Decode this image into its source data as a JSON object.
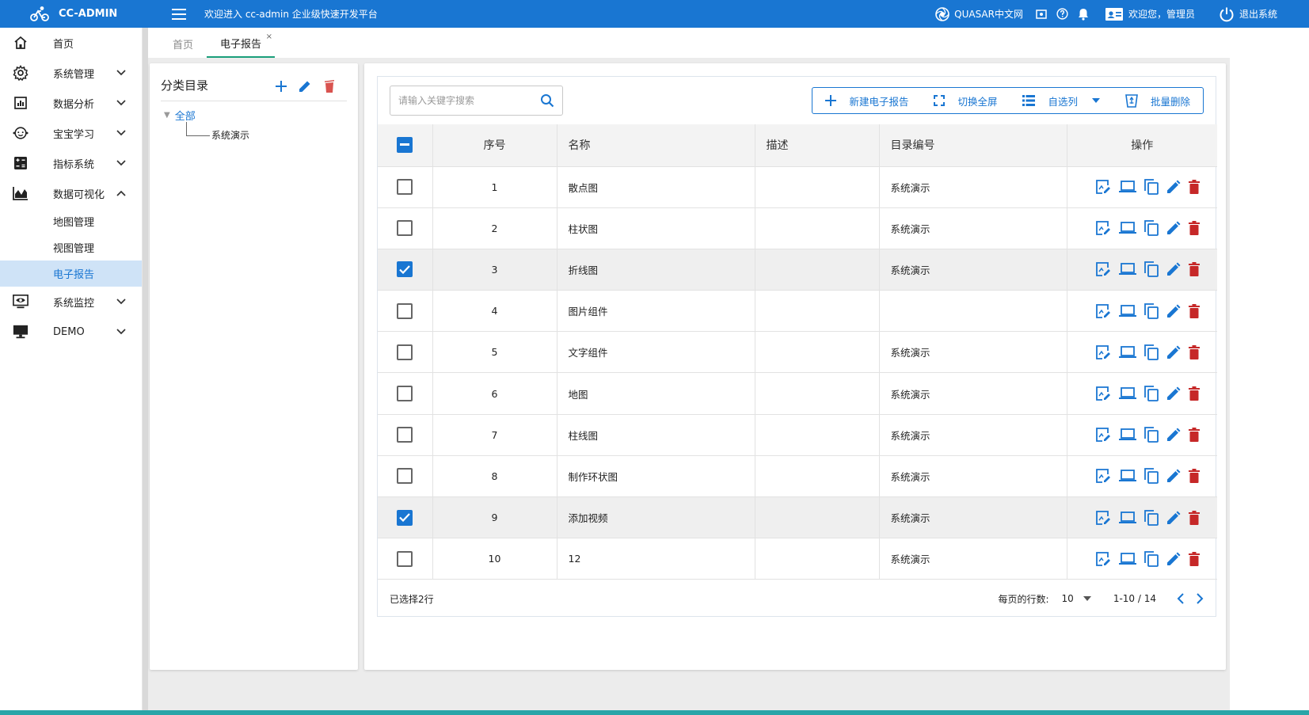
{
  "header": {
    "app_name": "CC-ADMIN",
    "welcome": "欢迎进入 cc-admin 企业级快速开发平台",
    "quasar_link": "QUASAR中文网",
    "user_text": "欢迎您，管理员",
    "logout": "退出系统"
  },
  "sidebar": {
    "items": [
      {
        "label": "首页"
      },
      {
        "label": "系统管理"
      },
      {
        "label": "数据分析"
      },
      {
        "label": "宝宝学习"
      },
      {
        "label": "指标系统"
      },
      {
        "label": "数据可视化"
      },
      {
        "label": "系统监控"
      },
      {
        "label": "DEMO"
      }
    ],
    "sub_items": [
      {
        "label": "地图管理"
      },
      {
        "label": "视图管理"
      },
      {
        "label": "电子报告"
      }
    ]
  },
  "tabs": [
    {
      "label": "首页"
    },
    {
      "label": "电子报告",
      "close": "×"
    }
  ],
  "category": {
    "title": "分类目录",
    "root": "全部",
    "children": [
      "系统演示"
    ]
  },
  "toolbar": {
    "search_placeholder": "请输入关键字搜索",
    "new_report": "新建电子报告",
    "fullscreen": "切换全屏",
    "columns": "自选列",
    "batch_delete": "批量删除"
  },
  "table": {
    "headers": [
      "序号",
      "名称",
      "描述",
      "目录编号",
      "操作"
    ],
    "rows": [
      {
        "no": "1",
        "name": "散点图",
        "desc": "",
        "catalog": "系统演示",
        "checked": false
      },
      {
        "no": "2",
        "name": "柱状图",
        "desc": "",
        "catalog": "系统演示",
        "checked": false
      },
      {
        "no": "3",
        "name": "折线图",
        "desc": "",
        "catalog": "系统演示",
        "checked": true
      },
      {
        "no": "4",
        "name": "图片组件",
        "desc": "",
        "catalog": "",
        "checked": false
      },
      {
        "no": "5",
        "name": "文字组件",
        "desc": "",
        "catalog": "系统演示",
        "checked": false
      },
      {
        "no": "6",
        "name": "地图",
        "desc": "",
        "catalog": "系统演示",
        "checked": false
      },
      {
        "no": "7",
        "name": "柱线图",
        "desc": "",
        "catalog": "系统演示",
        "checked": false
      },
      {
        "no": "8",
        "name": "制作环状图",
        "desc": "",
        "catalog": "系统演示",
        "checked": false
      },
      {
        "no": "9",
        "name": "添加视频",
        "desc": "",
        "catalog": "系统演示",
        "checked": true
      },
      {
        "no": "10",
        "name": "12",
        "desc": "",
        "catalog": "系统演示",
        "checked": false
      }
    ]
  },
  "footer": {
    "selected": "已选择2行",
    "rows_per_page_label": "每页的行数:",
    "rows_per_page": "10",
    "range": "1-10 / 14"
  },
  "colors": {
    "primary": "#1976d2",
    "danger": "#c62828",
    "tab_active": "#1a9f7a"
  }
}
